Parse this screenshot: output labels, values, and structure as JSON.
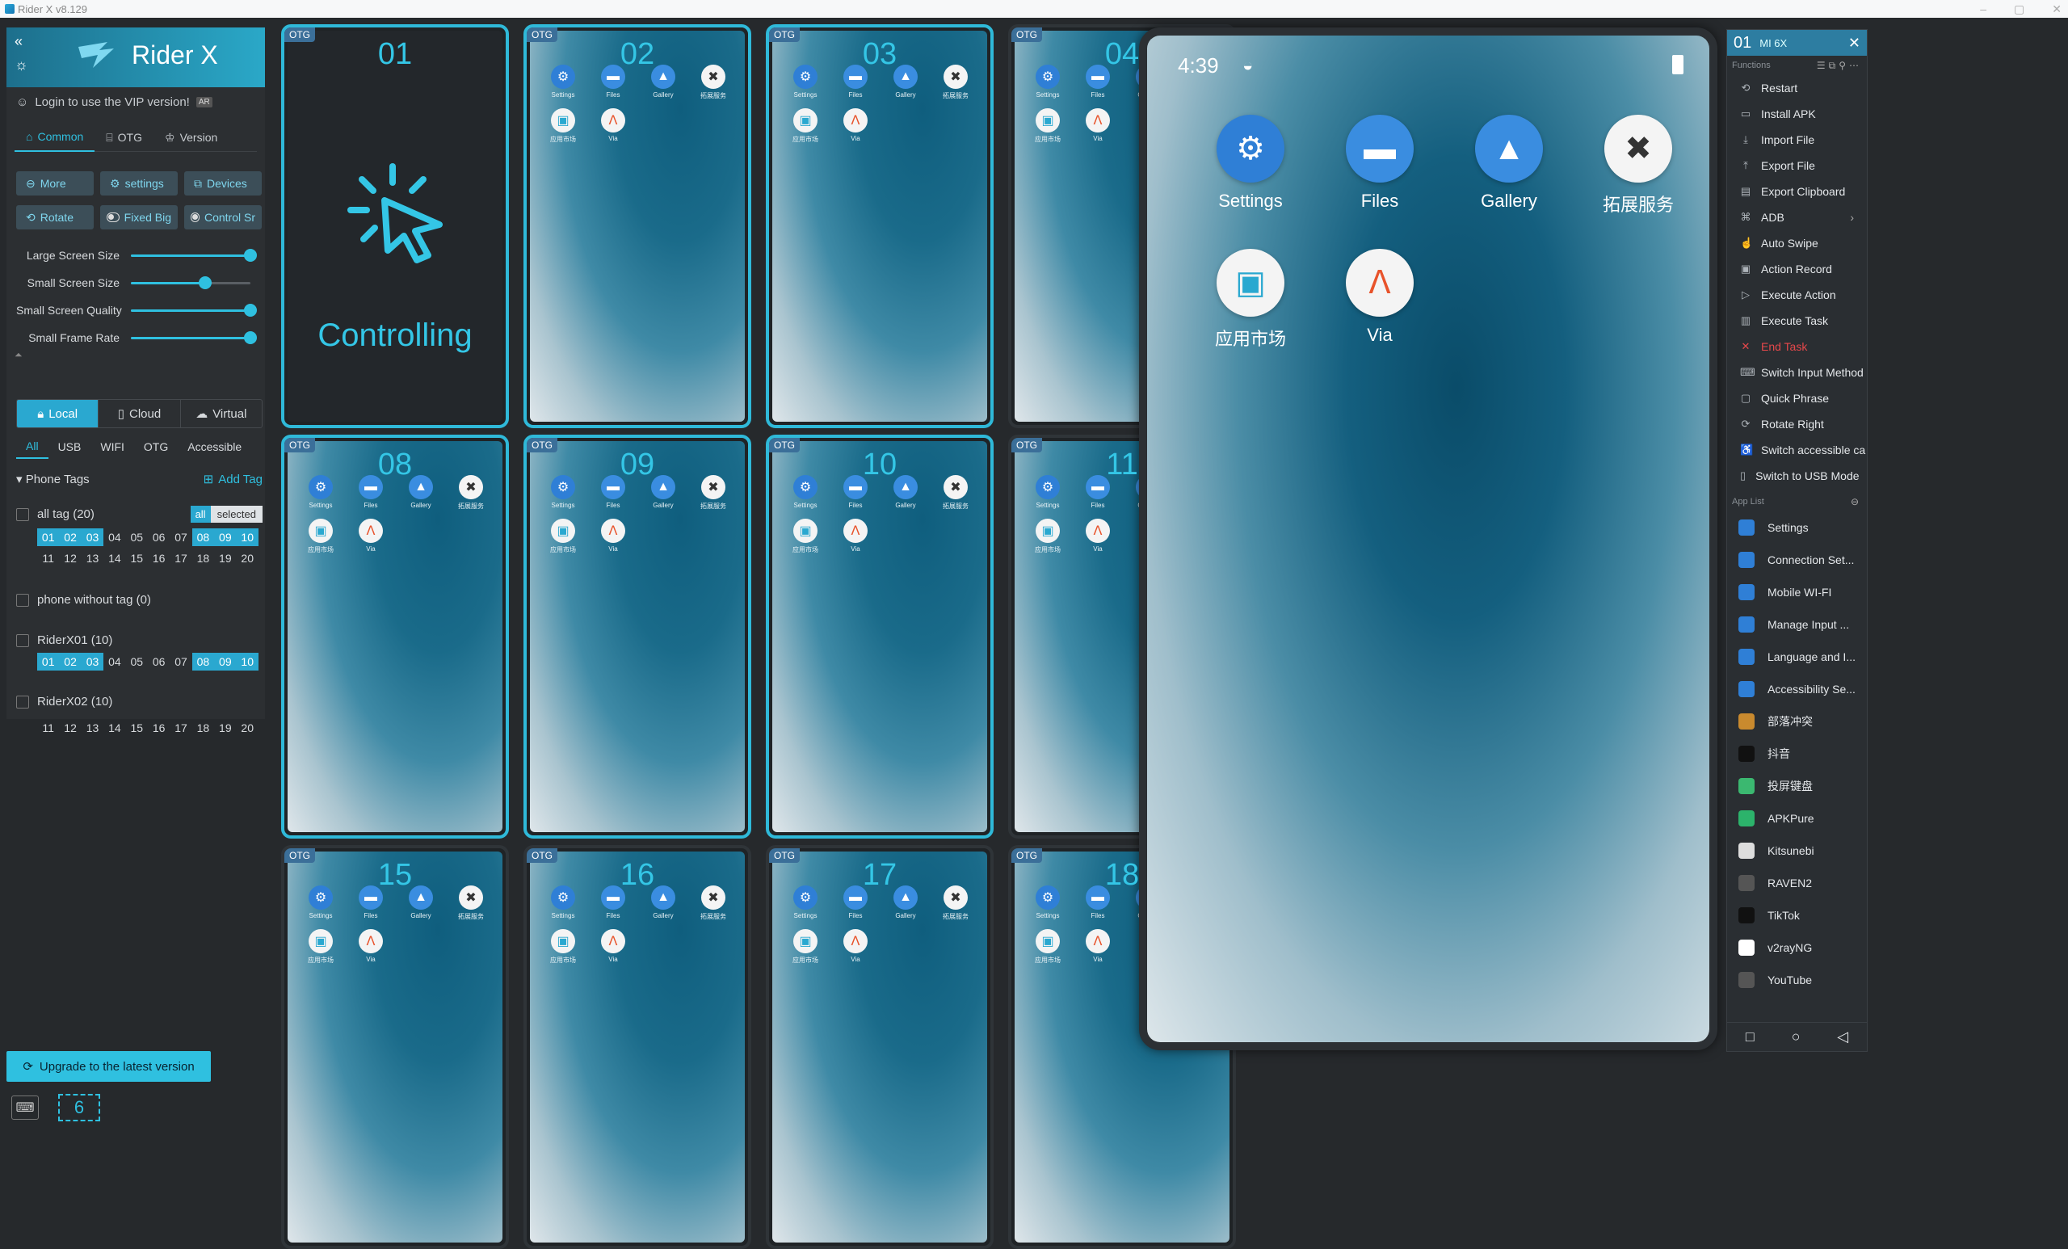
{
  "window": {
    "title": "Rider X v8.129",
    "btn_min": "–",
    "btn_max": "▢",
    "btn_close": "✕"
  },
  "sidebar": {
    "brand": "Rider X",
    "vip_text": "Login to use the VIP version!",
    "vip_badge": "AR",
    "tabs": [
      {
        "label": "Common",
        "icon": "home-icon"
      },
      {
        "label": "OTG",
        "icon": "bank-icon"
      },
      {
        "label": "Version",
        "icon": "crown-icon"
      }
    ],
    "buttons_row1": [
      {
        "label": "More",
        "icon": "more-icon"
      },
      {
        "label": "settings",
        "icon": "gear-icon"
      },
      {
        "label": "Devices",
        "icon": "devices-icon"
      }
    ],
    "buttons_row2": [
      {
        "label": "Rotate",
        "icon": "rotate-icon"
      },
      {
        "label": "Fixed Big",
        "icon": "toggle-icon"
      },
      {
        "label": "Control Sr",
        "icon": "toggle-icon"
      }
    ],
    "sliders": [
      {
        "label": "Large Screen Size",
        "value": 1.0
      },
      {
        "label": "Small Screen Size",
        "value": 0.62
      },
      {
        "label": "Small Screen Quality",
        "value": 1.0
      },
      {
        "label": "Small Frame Rate",
        "value": 1.0
      }
    ],
    "source_tabs": [
      {
        "label": "Local",
        "active": true
      },
      {
        "label": "Cloud",
        "active": false
      },
      {
        "label": "Virtual",
        "active": false
      }
    ],
    "filter_tabs": [
      "All",
      "USB",
      "WIFI",
      "OTG",
      "Accessible"
    ],
    "phone_tags_label": "Phone Tags",
    "add_tag_label": "Add Tag",
    "all_tag": {
      "label": "all tag (20)",
      "all_btn": "all",
      "selected_btn": "selected"
    },
    "all_tag_nums": [
      "01",
      "02",
      "03",
      "04",
      "05",
      "06",
      "07",
      "08",
      "09",
      "10",
      "11",
      "12",
      "13",
      "14",
      "15",
      "16",
      "17",
      "18",
      "19",
      "20"
    ],
    "all_tag_selected": [
      "01",
      "02",
      "03",
      "08",
      "09",
      "10"
    ],
    "no_tag_label": "phone without tag (0)",
    "riderx01": {
      "label": "RiderX01 (10)",
      "nums": [
        "01",
        "02",
        "03",
        "04",
        "05",
        "06",
        "07",
        "08",
        "09",
        "10"
      ],
      "selected": [
        "01",
        "02",
        "03",
        "08",
        "09",
        "10"
      ]
    },
    "riderx02": {
      "label": "RiderX02 (10)",
      "nums": [
        "11",
        "12",
        "13",
        "14",
        "15",
        "16",
        "17",
        "18",
        "19",
        "20"
      ],
      "selected": []
    },
    "upgrade_label": "Upgrade to the latest version",
    "count": "6"
  },
  "grid": {
    "otg_badge": "OTG",
    "controlling_number": "01",
    "controlling_label": "Controlling",
    "phones": [
      "02",
      "03",
      "04",
      "08",
      "09",
      "10",
      "11",
      "15",
      "16",
      "17",
      "18"
    ],
    "apps_row1": [
      "Settings",
      "Files",
      "Gallery",
      "拓展服务"
    ],
    "apps_row2": [
      "应用市场",
      "Via"
    ]
  },
  "big_phone": {
    "time": "4:39",
    "apps": [
      {
        "label": "Settings",
        "icon": "gear-icon",
        "bg": "#2f7fd6"
      },
      {
        "label": "Files",
        "icon": "folder-icon",
        "bg": "#3a8de0"
      },
      {
        "label": "Gallery",
        "icon": "image-icon",
        "bg": "#3a8de0"
      },
      {
        "label": "拓展服务",
        "icon": "tools-icon",
        "bg": "#f4f4f4"
      },
      {
        "label": "应用市场",
        "icon": "store-icon",
        "bg": "#f4f4f4"
      },
      {
        "label": "Via",
        "icon": "via-icon",
        "bg": "#f4f4f4"
      }
    ]
  },
  "function_panel": {
    "device_number": "01",
    "device_name": "MI 6X",
    "functions_label": "Functions",
    "functions": [
      {
        "label": "Restart",
        "icon": "restart-icon",
        "danger": false
      },
      {
        "label": "Install APK",
        "icon": "install-icon",
        "danger": false
      },
      {
        "label": "Import File",
        "icon": "import-icon",
        "danger": false
      },
      {
        "label": "Export File",
        "icon": "export-icon",
        "danger": false
      },
      {
        "label": "Export Clipboard",
        "icon": "clipboard-icon",
        "danger": false
      },
      {
        "label": "ADB",
        "icon": "adb-icon",
        "danger": false,
        "submenu": true
      },
      {
        "label": "Auto Swipe",
        "icon": "swipe-icon",
        "danger": false
      },
      {
        "label": "Action Record",
        "icon": "record-icon",
        "danger": false
      },
      {
        "label": "Execute Action",
        "icon": "play-icon",
        "danger": false
      },
      {
        "label": "Execute Task",
        "icon": "task-icon",
        "danger": false
      },
      {
        "label": "End Task",
        "icon": "close-icon",
        "danger": true
      },
      {
        "label": "Switch Input Method",
        "icon": "keyboard-icon",
        "danger": false
      },
      {
        "label": "Quick Phrase",
        "icon": "phrase-icon",
        "danger": false
      },
      {
        "label": "Rotate Right",
        "icon": "rotate-icon",
        "danger": false
      },
      {
        "label": "Switch accessible ca",
        "icon": "accessibility-icon",
        "danger": false
      },
      {
        "label": "Switch to USB Mode",
        "icon": "usb-icon",
        "danger": false
      }
    ],
    "applist_label": "App List",
    "apps": [
      {
        "label": "Settings",
        "color": "#2f7fd6"
      },
      {
        "label": "Connection Set...",
        "color": "#2f7fd6"
      },
      {
        "label": "Mobile WI-FI",
        "color": "#2f7fd6"
      },
      {
        "label": "Manage Input ...",
        "color": "#2f7fd6"
      },
      {
        "label": "Language and I...",
        "color": "#2f7fd6"
      },
      {
        "label": "Accessibility Se...",
        "color": "#2f7fd6"
      },
      {
        "label": "部落冲突",
        "color": "#c98a2e"
      },
      {
        "label": "抖音",
        "color": "#111111"
      },
      {
        "label": "投屏键盘",
        "color": "#3bb870"
      },
      {
        "label": "APKPure",
        "color": "#2cb36b"
      },
      {
        "label": "Kitsunebi",
        "color": "#dddddd"
      },
      {
        "label": "RAVEN2",
        "color": "#555555"
      },
      {
        "label": "TikTok",
        "color": "#111111"
      },
      {
        "label": "v2rayNG",
        "color": "#ffffff"
      },
      {
        "label": "YouTube",
        "color": "#555555"
      }
    ],
    "nav": [
      "□",
      "○",
      "◁"
    ]
  }
}
